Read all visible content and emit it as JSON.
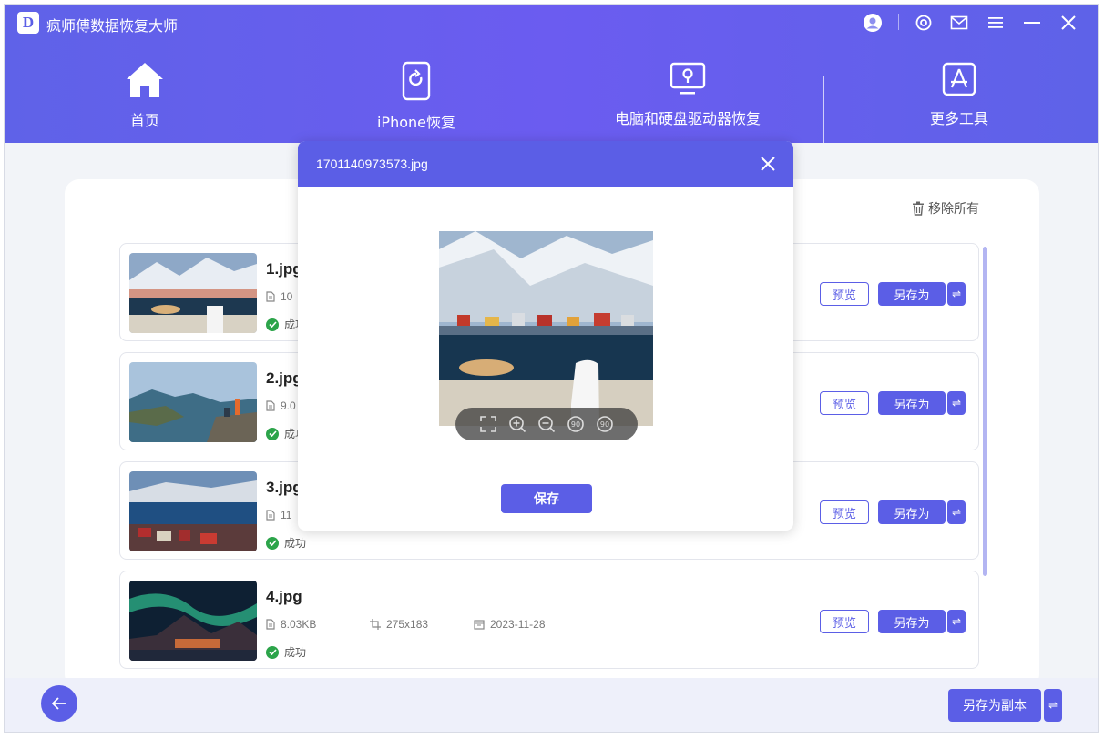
{
  "app": {
    "logo": "D",
    "title": "疯师傅数据恢复大师"
  },
  "window_controls": [
    {
      "icon": "user-avatar-icon"
    },
    {
      "icon": "settings-icon"
    },
    {
      "icon": "mail-icon"
    },
    {
      "icon": "menu-icon"
    },
    {
      "icon": "minimize-icon"
    },
    {
      "icon": "close-icon"
    }
  ],
  "nav": [
    {
      "label": "首页",
      "icon": "home-icon"
    },
    {
      "label": "iPhone恢复",
      "icon": "phone-recover-icon"
    },
    {
      "label": "电脑和硬盘驱动器恢复",
      "icon": "computer-drive-icon"
    },
    {
      "label": "更多工具",
      "icon": "app-store-icon",
      "active": true
    }
  ],
  "list": {
    "remove_all_label": "移除所有",
    "items": [
      {
        "name": "1.jpg",
        "size": "10",
        "status": "成功"
      },
      {
        "name": "2.jpg",
        "size": "9.0",
        "status": "成功"
      },
      {
        "name": "3.jpg",
        "size": "11",
        "status": "成功"
      },
      {
        "name": "4.jpg",
        "size": "8.03KB",
        "dimensions": "275x183",
        "date": "2023-11-28",
        "status": "成功"
      }
    ],
    "preview_label": "预览",
    "save_as_label": "另存为",
    "swap_label": "⇌"
  },
  "footer": {
    "save_copy_label": "另存为副本",
    "swap_label": "⇌"
  },
  "modal": {
    "title": "1701140973573.jpg",
    "toolbar": [
      {
        "icon": "fullscreen-icon"
      },
      {
        "icon": "zoom-in-icon"
      },
      {
        "icon": "zoom-out-icon"
      },
      {
        "icon": "rotate-left-90-icon",
        "label": "90"
      },
      {
        "icon": "rotate-right-90-icon",
        "label": "90"
      }
    ],
    "save_label": "保存"
  },
  "colors": {
    "accent": "#5b5ee6",
    "success": "#2ca44a"
  }
}
